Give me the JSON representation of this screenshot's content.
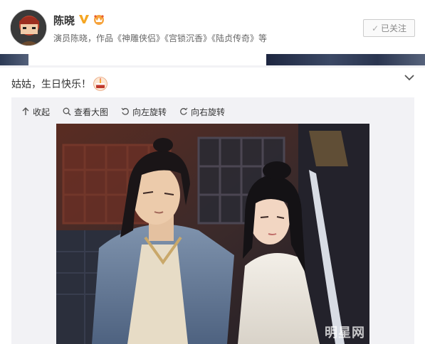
{
  "profile": {
    "name": "陈晓",
    "bio": "演员陈晓，作品《神雕侠侣》《宫锁沉香》《陆贞传奇》等",
    "follow_label": "已关注"
  },
  "post": {
    "text": "姑姑，生日快乐！"
  },
  "toolbar": {
    "collapse": "收起",
    "view_large": "查看大图",
    "rotate_left": "向左旋转",
    "rotate_right": "向右旋转"
  },
  "watermark": "明星网",
  "colors": {
    "verified_badge": "#f5a623",
    "panel_bg": "#f2f2f5",
    "text": "#333333"
  }
}
